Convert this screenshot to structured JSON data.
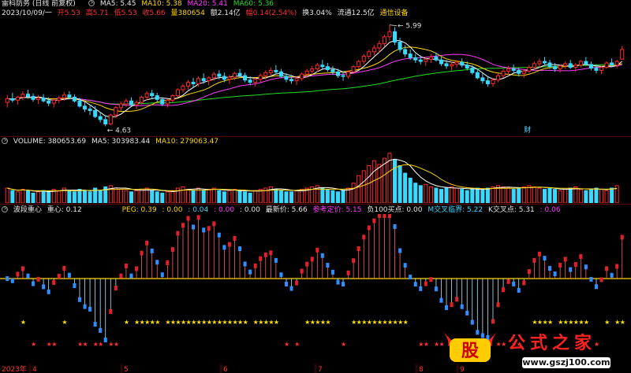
{
  "header": {
    "title": "雷科防务 (日线 前复权)",
    "date_info": "2023/10/09/一",
    "open": "开5.53",
    "high": "高5.71",
    "low": "低5.53",
    "close": "收5.66",
    "volume": "量380654",
    "amount": "额2.14亿",
    "change": "幅0.14(2.54%)",
    "turnover": "换3.04%",
    "float_cap": "流通12.5亿",
    "sector": "通信设备"
  },
  "ma_legend": {
    "ma5": "MA5: 5.45",
    "ma10": "MA10: 5.38",
    "ma20": "MA20: 5.41",
    "ma60": "MA60: 5.36"
  },
  "price_marks": {
    "high": "5.99",
    "low": "4.63",
    "event": "财"
  },
  "volume_legend": {
    "volume": "VOLUME: 380653.69",
    "ma5": "MA5: 303983.44",
    "ma10": "MA10: 279063.47"
  },
  "indicator_legend": {
    "name": "波段重心",
    "center": "重心: 0.12",
    "peg": "PEG: 0.39",
    "v1": ": 0.00",
    "v2": ": 0.04",
    "v3": ": 0.00",
    "v4": ": 0.00",
    "latest": "最新价: 5.66",
    "ref": "参考定价: 5.15",
    "buy": "负100买点: 0.00",
    "mcross": "M交叉临界: 5.22",
    "kcross": "K交叉点: 5.31",
    "v5": ": 0.06"
  },
  "axis": {
    "year": "2023年",
    "labels": [
      "4",
      "5",
      "6",
      "7",
      "8",
      "9"
    ]
  },
  "watermark": {
    "logo": "股",
    "text": "公式之家",
    "url": "www.gszj100.com"
  },
  "colors": {
    "up": "#ff2a2a",
    "down": "#38d8ff",
    "ma5": "#ffffff",
    "ma10": "#ffd800",
    "ma20": "#ff3cff",
    "ma60": "#22dd22"
  },
  "chart_data": {
    "type": "candlestick",
    "candles_ohlc": [
      [
        4.95,
        5.05,
        4.88,
        5.0
      ],
      [
        5.0,
        5.08,
        4.95,
        4.98
      ],
      [
        4.98,
        5.04,
        4.92,
        5.02
      ],
      [
        5.02,
        5.1,
        4.98,
        5.06
      ],
      [
        5.06,
        5.12,
        5.0,
        5.03
      ],
      [
        5.03,
        5.07,
        4.96,
        4.99
      ],
      [
        4.99,
        5.05,
        4.93,
        5.01
      ],
      [
        5.01,
        5.06,
        4.95,
        4.97
      ],
      [
        4.97,
        5.02,
        4.9,
        4.94
      ],
      [
        4.94,
        5.0,
        4.88,
        4.98
      ],
      [
        4.98,
        5.04,
        4.94,
        5.01
      ],
      [
        5.01,
        5.09,
        4.97,
        5.05
      ],
      [
        5.05,
        5.1,
        4.99,
        5.02
      ],
      [
        5.02,
        5.06,
        4.95,
        4.97
      ],
      [
        4.97,
        5.01,
        4.88,
        4.9
      ],
      [
        4.9,
        4.95,
        4.82,
        4.86
      ],
      [
        4.86,
        4.92,
        4.78,
        4.84
      ],
      [
        4.84,
        4.9,
        4.74,
        4.76
      ],
      [
        4.76,
        4.82,
        4.68,
        4.72
      ],
      [
        4.72,
        4.78,
        4.63,
        4.66
      ],
      [
        4.66,
        4.8,
        4.64,
        4.78
      ],
      [
        4.78,
        4.9,
        4.74,
        4.88
      ],
      [
        4.88,
        4.96,
        4.84,
        4.93
      ],
      [
        4.93,
        5.0,
        4.89,
        4.97
      ],
      [
        4.97,
        5.02,
        4.9,
        4.92
      ],
      [
        4.92,
        4.98,
        4.86,
        4.95
      ],
      [
        4.95,
        5.04,
        4.92,
        5.02
      ],
      [
        5.02,
        5.1,
        4.98,
        5.07
      ],
      [
        5.07,
        5.12,
        5.0,
        5.04
      ],
      [
        5.04,
        5.08,
        4.96,
        4.99
      ],
      [
        4.99,
        5.02,
        4.9,
        4.93
      ],
      [
        4.93,
        5.0,
        4.88,
        4.98
      ],
      [
        4.98,
        5.06,
        4.95,
        5.04
      ],
      [
        5.04,
        5.14,
        5.02,
        5.12
      ],
      [
        5.12,
        5.2,
        5.08,
        5.17
      ],
      [
        5.17,
        5.25,
        5.12,
        5.22
      ],
      [
        5.22,
        5.28,
        5.15,
        5.2
      ],
      [
        5.2,
        5.3,
        5.16,
        5.27
      ],
      [
        5.27,
        5.34,
        5.2,
        5.24
      ],
      [
        5.24,
        5.3,
        5.18,
        5.28
      ],
      [
        5.28,
        5.36,
        5.24,
        5.33
      ],
      [
        5.33,
        5.38,
        5.26,
        5.3
      ],
      [
        5.3,
        5.35,
        5.22,
        5.26
      ],
      [
        5.26,
        5.32,
        5.2,
        5.29
      ],
      [
        5.29,
        5.36,
        5.25,
        5.34
      ],
      [
        5.34,
        5.4,
        5.28,
        5.31
      ],
      [
        5.31,
        5.35,
        5.22,
        5.25
      ],
      [
        5.25,
        5.3,
        5.18,
        5.22
      ],
      [
        5.22,
        5.28,
        5.16,
        5.26
      ],
      [
        5.26,
        5.34,
        5.22,
        5.31
      ],
      [
        5.31,
        5.38,
        5.26,
        5.35
      ],
      [
        5.35,
        5.42,
        5.3,
        5.38
      ],
      [
        5.38,
        5.45,
        5.33,
        5.36
      ],
      [
        5.36,
        5.4,
        5.28,
        5.3
      ],
      [
        5.3,
        5.34,
        5.22,
        5.26
      ],
      [
        5.26,
        5.32,
        5.2,
        5.24
      ],
      [
        5.24,
        5.3,
        5.18,
        5.27
      ],
      [
        5.27,
        5.35,
        5.24,
        5.33
      ],
      [
        5.33,
        5.4,
        5.28,
        5.37
      ],
      [
        5.37,
        5.44,
        5.32,
        5.4
      ],
      [
        5.4,
        5.48,
        5.36,
        5.45
      ],
      [
        5.45,
        5.52,
        5.4,
        5.43
      ],
      [
        5.43,
        5.48,
        5.36,
        5.39
      ],
      [
        5.39,
        5.44,
        5.32,
        5.36
      ],
      [
        5.36,
        5.4,
        5.28,
        5.31
      ],
      [
        5.31,
        5.36,
        5.24,
        5.3
      ],
      [
        5.3,
        5.38,
        5.27,
        5.36
      ],
      [
        5.36,
        5.45,
        5.33,
        5.43
      ],
      [
        5.43,
        5.52,
        5.4,
        5.5
      ],
      [
        5.5,
        5.6,
        5.46,
        5.57
      ],
      [
        5.57,
        5.66,
        5.53,
        5.63
      ],
      [
        5.63,
        5.72,
        5.58,
        5.68
      ],
      [
        5.68,
        5.78,
        5.62,
        5.74
      ],
      [
        5.74,
        5.86,
        5.7,
        5.83
      ],
      [
        5.83,
        5.99,
        5.78,
        5.9
      ],
      [
        5.9,
        5.96,
        5.72,
        5.76
      ],
      [
        5.76,
        5.82,
        5.62,
        5.66
      ],
      [
        5.66,
        5.72,
        5.56,
        5.6
      ],
      [
        5.6,
        5.66,
        5.52,
        5.55
      ],
      [
        5.55,
        5.6,
        5.48,
        5.52
      ],
      [
        5.52,
        5.58,
        5.46,
        5.5
      ],
      [
        5.5,
        5.56,
        5.44,
        5.53
      ],
      [
        5.53,
        5.6,
        5.48,
        5.56
      ],
      [
        5.56,
        5.62,
        5.5,
        5.52
      ],
      [
        5.52,
        5.56,
        5.44,
        5.47
      ],
      [
        5.47,
        5.52,
        5.4,
        5.44
      ],
      [
        5.44,
        5.5,
        5.38,
        5.46
      ],
      [
        5.46,
        5.52,
        5.42,
        5.49
      ],
      [
        5.49,
        5.54,
        5.42,
        5.45
      ],
      [
        5.45,
        5.5,
        5.38,
        5.41
      ],
      [
        5.41,
        5.45,
        5.32,
        5.35
      ],
      [
        5.35,
        5.4,
        5.26,
        5.28
      ],
      [
        5.28,
        5.34,
        5.2,
        5.24
      ],
      [
        5.24,
        5.3,
        5.16,
        5.2
      ],
      [
        5.2,
        5.28,
        5.16,
        5.25
      ],
      [
        5.25,
        5.34,
        5.22,
        5.31
      ],
      [
        5.31,
        5.4,
        5.28,
        5.37
      ],
      [
        5.37,
        5.44,
        5.32,
        5.4
      ],
      [
        5.4,
        5.46,
        5.34,
        5.38
      ],
      [
        5.38,
        5.42,
        5.3,
        5.34
      ],
      [
        5.34,
        5.4,
        5.28,
        5.37
      ],
      [
        5.37,
        5.45,
        5.34,
        5.42
      ],
      [
        5.42,
        5.5,
        5.38,
        5.47
      ],
      [
        5.47,
        5.54,
        5.42,
        5.5
      ],
      [
        5.5,
        5.56,
        5.44,
        5.48
      ],
      [
        5.48,
        5.52,
        5.4,
        5.43
      ],
      [
        5.43,
        5.48,
        5.36,
        5.4
      ],
      [
        5.4,
        5.46,
        5.35,
        5.44
      ],
      [
        5.44,
        5.5,
        5.4,
        5.47
      ],
      [
        5.47,
        5.52,
        5.4,
        5.42
      ],
      [
        5.42,
        5.48,
        5.36,
        5.45
      ],
      [
        5.45,
        5.52,
        5.42,
        5.5
      ],
      [
        5.5,
        5.56,
        5.44,
        5.46
      ],
      [
        5.46,
        5.5,
        5.38,
        5.41
      ],
      [
        5.41,
        5.46,
        5.34,
        5.38
      ],
      [
        5.38,
        5.44,
        5.33,
        5.42
      ],
      [
        5.42,
        5.5,
        5.4,
        5.48
      ],
      [
        5.48,
        5.54,
        5.42,
        5.45
      ],
      [
        5.45,
        5.52,
        5.41,
        5.5
      ],
      [
        5.53,
        5.71,
        5.53,
        5.66
      ]
    ],
    "volumes": [
      1.2,
      1.0,
      0.9,
      1.1,
      1.0,
      0.8,
      0.9,
      1.0,
      0.9,
      1.1,
      1.0,
      1.2,
      1.0,
      0.9,
      1.1,
      1.0,
      0.9,
      1.2,
      1.0,
      1.3,
      1.4,
      1.2,
      1.1,
      1.0,
      0.9,
      1.0,
      1.1,
      1.2,
      1.0,
      0.9,
      0.8,
      0.9,
      1.0,
      1.2,
      1.3,
      1.1,
      1.0,
      1.2,
      1.0,
      1.1,
      1.2,
      1.0,
      0.9,
      1.0,
      1.1,
      1.0,
      0.9,
      0.8,
      1.0,
      1.1,
      1.2,
      1.3,
      1.1,
      1.0,
      0.9,
      0.9,
      1.0,
      1.1,
      1.2,
      1.3,
      1.4,
      1.2,
      1.1,
      1.0,
      0.9,
      1.0,
      1.2,
      1.6,
      2.2,
      2.6,
      3.0,
      3.4,
      3.1,
      3.6,
      4.0,
      3.5,
      3.0,
      2.4,
      2.0,
      1.6,
      1.4,
      1.5,
      1.3,
      1.2,
      1.1,
      1.2,
      1.3,
      1.2,
      1.1,
      1.0,
      1.1,
      1.2,
      1.1,
      1.2,
      1.3,
      1.4,
      1.3,
      1.2,
      1.1,
      1.2,
      1.3,
      1.4,
      1.3,
      1.2,
      1.1,
      1.2,
      1.1,
      1.0,
      1.1,
      1.2,
      1.3,
      1.1,
      1.0,
      1.1,
      1.2,
      1.1,
      1.0,
      1.2,
      1.4
    ]
  }
}
